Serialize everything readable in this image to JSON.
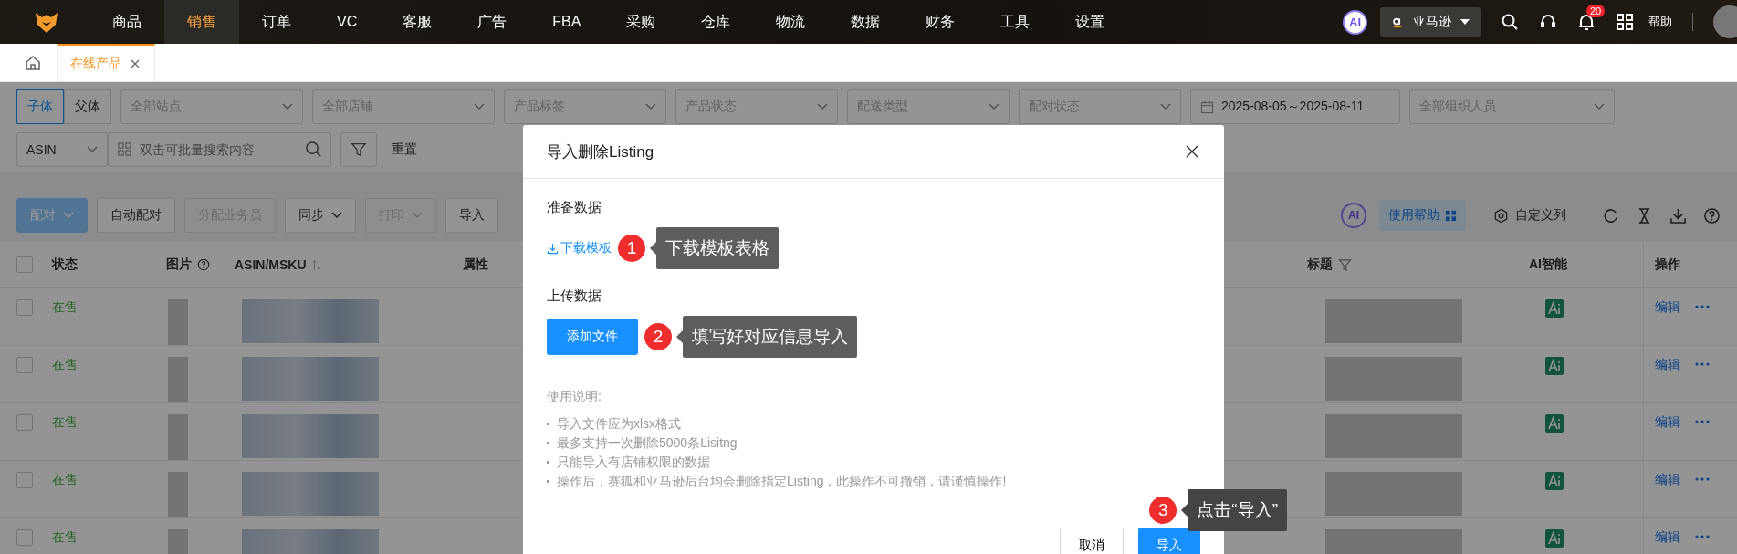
{
  "top_nav": {
    "items": [
      {
        "label": "商品",
        "selected": false
      },
      {
        "label": "销售",
        "selected": true
      },
      {
        "label": "订单",
        "selected": false
      },
      {
        "label": "VC",
        "selected": false
      },
      {
        "label": "客服",
        "selected": false
      },
      {
        "label": "广告",
        "selected": false
      },
      {
        "label": "FBA",
        "selected": false
      },
      {
        "label": "采购",
        "selected": false
      },
      {
        "label": "仓库",
        "selected": false
      },
      {
        "label": "物流",
        "selected": false
      },
      {
        "label": "数据",
        "selected": false
      },
      {
        "label": "财务",
        "selected": false
      },
      {
        "label": "工具",
        "selected": false
      },
      {
        "label": "设置",
        "selected": false
      }
    ],
    "ai_badge": "AI",
    "marketplace": "亚马逊",
    "notification_count": "20",
    "help": "帮助"
  },
  "tabs": [
    {
      "label": "在线产品",
      "selected": true
    }
  ],
  "filters": {
    "variant_toggle": [
      {
        "label": "子体",
        "selected": true
      },
      {
        "label": "父体",
        "selected": false
      }
    ],
    "selects": [
      {
        "placeholder": "全部站点"
      },
      {
        "placeholder": "全部店铺"
      },
      {
        "placeholder": "产品标签"
      },
      {
        "placeholder": "产品状态"
      },
      {
        "placeholder": "配送类型"
      },
      {
        "placeholder": "配对状态"
      }
    ],
    "date_range": "2025-08-05～2025-08-11",
    "org_placeholder": "全部组织人员",
    "search_type": "ASIN",
    "search_placeholder": "双击可批量搜索内容",
    "reset": "重置"
  },
  "toolbar": {
    "buttons": [
      {
        "label": "配对",
        "kind": "primary",
        "disabled": true,
        "dropdown": true
      },
      {
        "label": "自动配对",
        "kind": "default",
        "disabled": false,
        "dropdown": false
      },
      {
        "label": "分配业务员",
        "kind": "default",
        "disabled": true,
        "dropdown": false
      },
      {
        "label": "同步",
        "kind": "default",
        "disabled": false,
        "dropdown": true
      },
      {
        "label": "打印",
        "kind": "default",
        "disabled": true,
        "dropdown": true
      },
      {
        "label": "导入",
        "kind": "default",
        "disabled": false,
        "dropdown": false
      }
    ],
    "ai_badge": "AI",
    "help_button": "使用帮助",
    "custom_columns": "自定义列"
  },
  "table": {
    "all_selected": false,
    "columns": [
      {
        "label": "状态",
        "kind": "plain"
      },
      {
        "label": "图片",
        "kind": "help"
      },
      {
        "label": "ASIN/MSKU",
        "kind": "sort"
      },
      {
        "label": "属性",
        "kind": "plain"
      },
      {
        "label": "标题",
        "kind": "filter"
      },
      {
        "label": "AI智能",
        "kind": "plain"
      },
      {
        "label": "操作",
        "kind": "plain"
      }
    ],
    "rows": [
      {
        "selected": false,
        "status": "在售",
        "action": "编辑"
      },
      {
        "selected": false,
        "status": "在售",
        "action": "编辑"
      },
      {
        "selected": false,
        "status": "在售",
        "action": "编辑"
      },
      {
        "selected": false,
        "status": "在售",
        "action": "编辑"
      },
      {
        "selected": false,
        "status": "在售",
        "action": "编辑"
      }
    ]
  },
  "modal": {
    "title": "导入删除Listing",
    "prepare_heading": "准备数据",
    "download_link": "下载模板",
    "upload_heading": "上传数据",
    "add_file_button": "添加文件",
    "instructions_heading": "使用说明:",
    "instructions": [
      "导入文件应为xlsx格式",
      "最多支持一次删除5000条Lisitng",
      "只能导入有店铺权限的数据",
      "操作后，赛狐和亚马逊后台均会删除指定Listing，此操作不可撤销，请谨慎操作!"
    ],
    "cancel_button": "取消",
    "import_button": "导入"
  },
  "annotations": [
    {
      "number": "1",
      "text": "下载模板表格"
    },
    {
      "number": "2",
      "text": "填写好对应信息导入"
    },
    {
      "number": "3",
      "text": "点击“导入”"
    }
  ]
}
